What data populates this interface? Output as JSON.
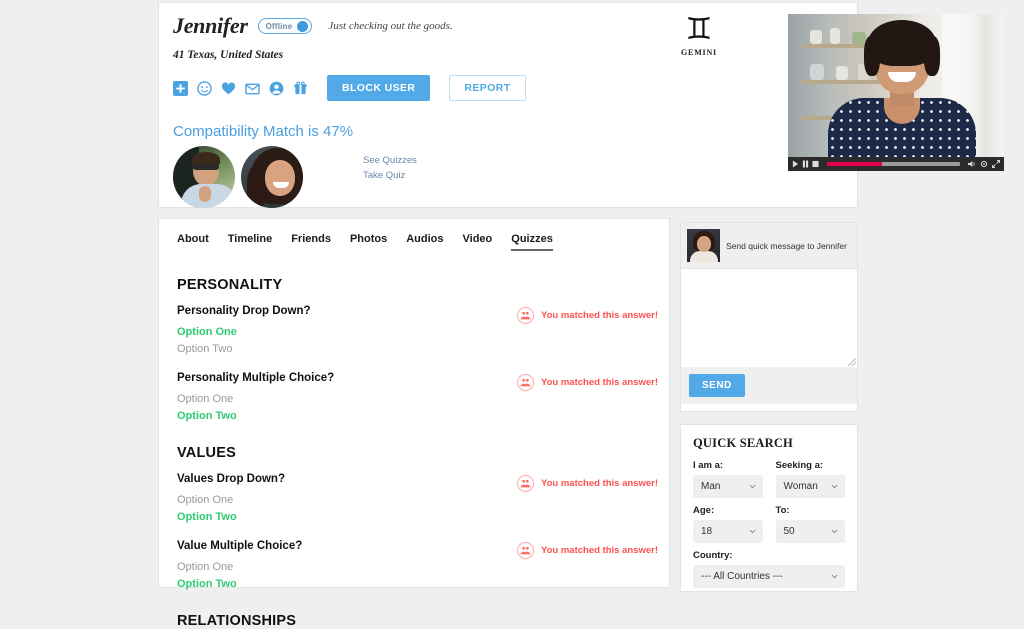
{
  "profile": {
    "name": "Jennifer",
    "status": "Offline",
    "tagline": "Just checking out the goods.",
    "location": "41 Texas, United States",
    "actions": {
      "icons": [
        "add-friend-icon",
        "wink-icon",
        "favorite-heart-icon",
        "message-envelope-icon",
        "view-profile-icon",
        "send-gift-icon"
      ],
      "block_label": "BLOCK USER",
      "report_label": "REPORT"
    },
    "zodiac": {
      "glyph": "♊",
      "name": "GEMINI"
    },
    "compatibility": {
      "title": "Compatibility Match is 47%",
      "percent": 47,
      "links": [
        "See Quizzes",
        "Take Quiz"
      ]
    }
  },
  "video": {
    "controls": [
      "play-icon",
      "pause-icon",
      "stop-icon"
    ],
    "progress_percent": 41,
    "right_controls": [
      "volume-icon",
      "settings-gear-icon",
      "fullscreen-icon"
    ]
  },
  "tabs": [
    {
      "label": "About",
      "active": false
    },
    {
      "label": "Timeline",
      "active": false
    },
    {
      "label": "Friends",
      "active": false
    },
    {
      "label": "Photos",
      "active": false
    },
    {
      "label": "Audios",
      "active": false
    },
    {
      "label": "Video",
      "active": false
    },
    {
      "label": "Quizzes",
      "active": true
    }
  ],
  "quiz_sections": [
    {
      "title": "PERSONALITY",
      "questions": [
        {
          "text": "Personality Drop Down?",
          "options": [
            {
              "label": "Option One",
              "selected": true
            },
            {
              "label": "Option Two",
              "selected": false
            }
          ],
          "matched_label": "You matched this answer!"
        },
        {
          "text": "Personality Multiple Choice?",
          "options": [
            {
              "label": "Option One",
              "selected": false
            },
            {
              "label": "Option Two",
              "selected": true
            }
          ],
          "matched_label": "You matched this answer!"
        }
      ]
    },
    {
      "title": "VALUES",
      "questions": [
        {
          "text": "Values Drop Down?",
          "options": [
            {
              "label": "Option One",
              "selected": false
            },
            {
              "label": "Option Two",
              "selected": true
            }
          ],
          "matched_label": "You matched this answer!"
        },
        {
          "text": "Value Multiple Choice?",
          "options": [
            {
              "label": "Option One",
              "selected": false
            },
            {
              "label": "Option Two",
              "selected": true
            }
          ],
          "matched_label": "You matched this answer!"
        }
      ]
    },
    {
      "title": "RELATIONSHIPS",
      "questions": []
    }
  ],
  "quick_message": {
    "header": "Send quick message to  Jennifer",
    "textarea_value": "",
    "textarea_placeholder": "",
    "send_label": "SEND"
  },
  "quick_search": {
    "title": "QUICK SEARCH",
    "fields": [
      {
        "label": "I am a:",
        "value": "Man"
      },
      {
        "label": "Seeking a:",
        "value": "Woman"
      },
      {
        "label": "Age:",
        "value": "18"
      },
      {
        "label": "To:",
        "value": "50"
      },
      {
        "label": "Country:",
        "value": "--- All Countries ---"
      }
    ]
  },
  "colors": {
    "accent_blue": "#52a9e8",
    "link_blue": "#4a9fe0",
    "match_red": "#ff5050",
    "selected_green": "#2ecc71",
    "page_bg": "#efefef"
  }
}
